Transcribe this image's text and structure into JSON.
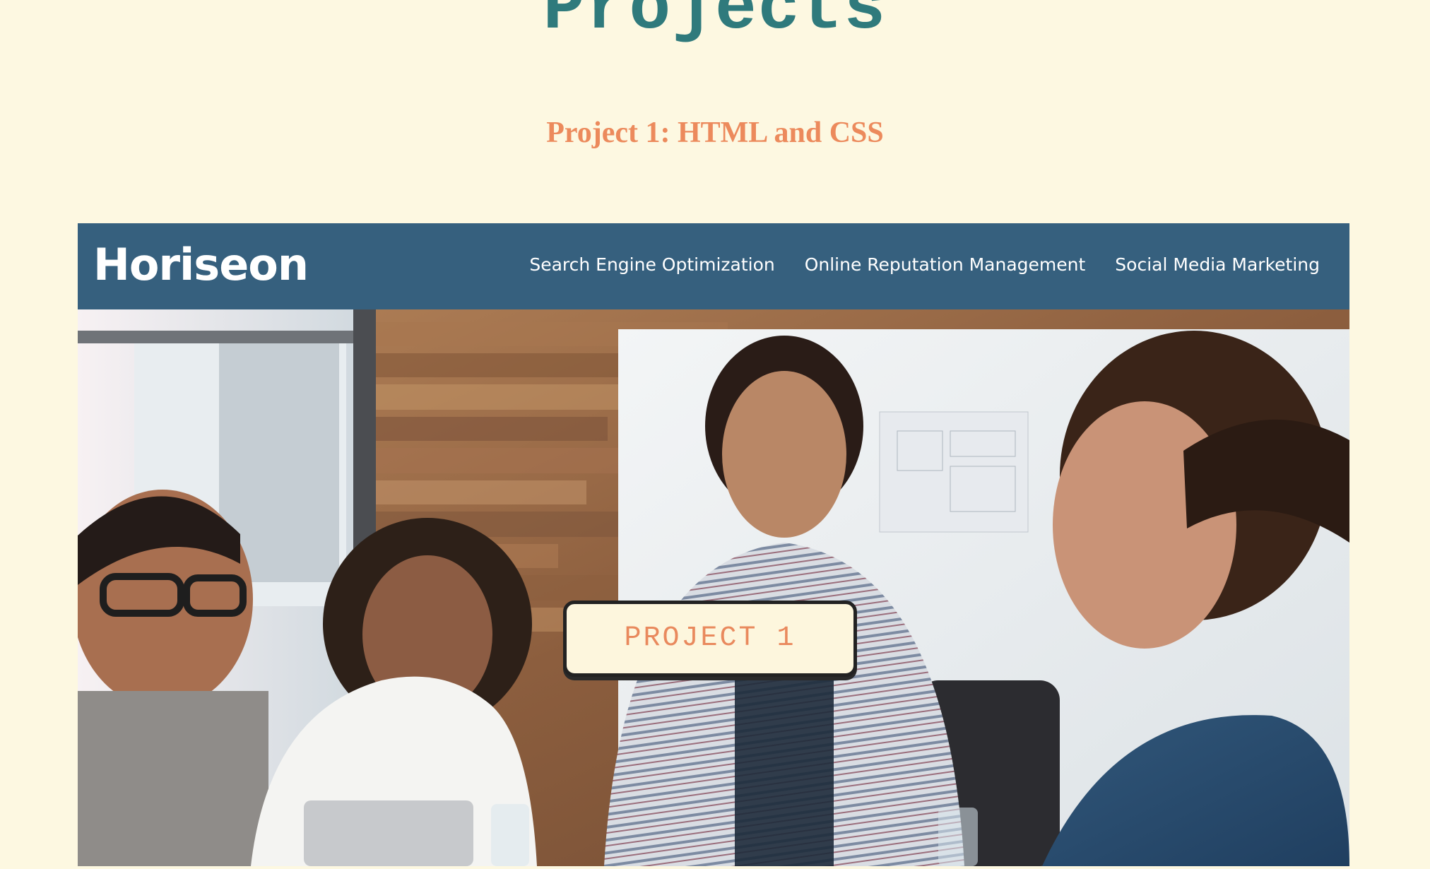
{
  "section": {
    "title": "Projects"
  },
  "project": {
    "heading": "Project 1: HTML and CSS",
    "button_label": "PROJECT 1",
    "preview": {
      "logo": "Horiseon",
      "nav": [
        "Search Engine Optimization",
        "Online Reputation Management",
        "Social Media Marketing"
      ]
    }
  },
  "colors": {
    "page_background": "#fdf8e1",
    "title_teal": "#2f7a7c",
    "accent_orange": "#ec8a5c",
    "preview_header_blue": "#36607e"
  },
  "images": {
    "hero": "team-meeting-photo"
  }
}
